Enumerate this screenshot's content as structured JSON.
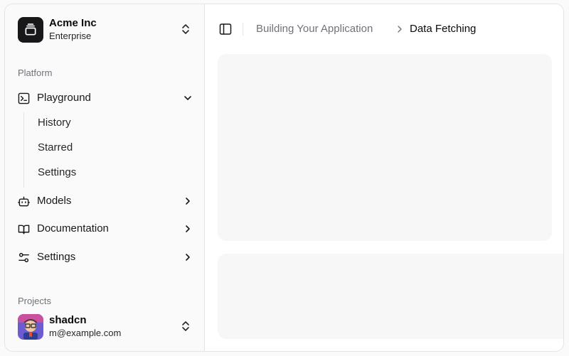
{
  "team": {
    "name": "Acme Inc",
    "plan": "Enterprise"
  },
  "platform": {
    "label": "Platform",
    "items": [
      {
        "label": "Playground",
        "icon": "terminal-icon",
        "expanded": true,
        "children": [
          {
            "label": "History"
          },
          {
            "label": "Starred"
          },
          {
            "label": "Settings"
          }
        ]
      },
      {
        "label": "Models",
        "icon": "bot-icon"
      },
      {
        "label": "Documentation",
        "icon": "book-icon"
      },
      {
        "label": "Settings",
        "icon": "sliders-icon"
      }
    ]
  },
  "projects": {
    "label": "Projects"
  },
  "user": {
    "name": "shadcn",
    "email": "m@example.com"
  },
  "breadcrumb": {
    "parent": "Building Your Application",
    "current": "Data Fetching"
  },
  "colors": {
    "accent": "#18181b",
    "muted_text": "#71717a",
    "border": "#e4e4e7",
    "placeholder": "#f7f7f7"
  }
}
